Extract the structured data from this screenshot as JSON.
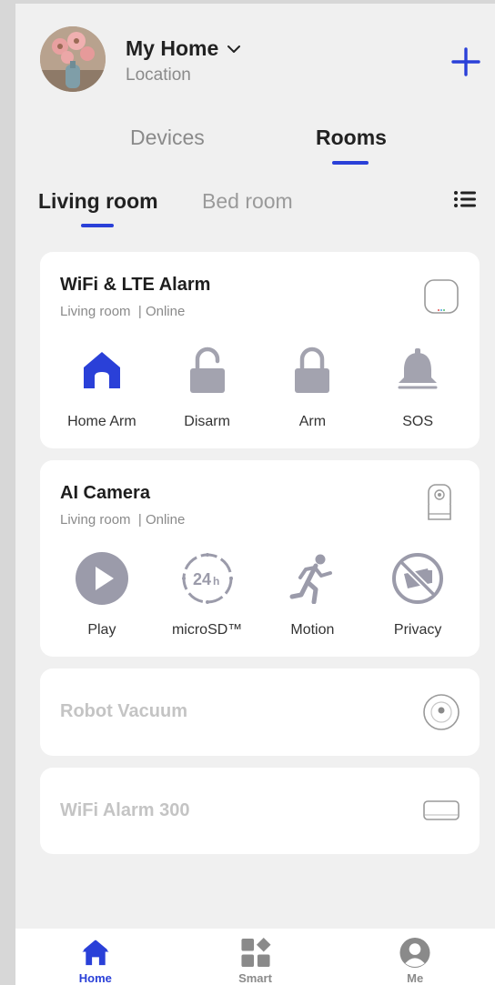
{
  "colors": {
    "accent": "#2a40d8",
    "icon_gray": "#a3a3af",
    "text_dim": "#c4c4c4"
  },
  "header": {
    "title": "My Home",
    "subtitle": "Location",
    "avatar_icon": "flower-vase-avatar",
    "add_icon": "plus-icon"
  },
  "top_tabs": [
    {
      "label": "Devices",
      "active": false
    },
    {
      "label": "Rooms",
      "active": true
    }
  ],
  "room_tabs": [
    {
      "label": "Living room",
      "active": true
    },
    {
      "label": "Bed room",
      "active": false
    }
  ],
  "devices": [
    {
      "name": "WiFi & LTE Alarm",
      "room": "Living room",
      "status": "Online",
      "actions": [
        {
          "label": "Home Arm",
          "icon": "home-icon",
          "active": true
        },
        {
          "label": "Disarm",
          "icon": "unlocked-padlock-icon",
          "active": false
        },
        {
          "label": "Arm",
          "icon": "locked-padlock-icon",
          "active": false
        },
        {
          "label": "SOS",
          "icon": "bell-icon",
          "active": false
        }
      ]
    },
    {
      "name": "AI Camera",
      "room": "Living room",
      "status": "Online",
      "actions": [
        {
          "label": "Play",
          "icon": "play-icon"
        },
        {
          "label": "microSD™",
          "icon": "24h-icon"
        },
        {
          "label": "Motion",
          "icon": "running-person-icon"
        },
        {
          "label": "Privacy",
          "icon": "camera-off-icon"
        }
      ]
    },
    {
      "name": "Robot Vacuum"
    },
    {
      "name": "WiFi Alarm 300"
    }
  ],
  "nav": [
    {
      "label": "Home",
      "icon": "home-icon",
      "active": true
    },
    {
      "label": "Smart",
      "icon": "smart-grid-icon",
      "active": false
    },
    {
      "label": "Me",
      "icon": "profile-icon",
      "active": false
    }
  ]
}
